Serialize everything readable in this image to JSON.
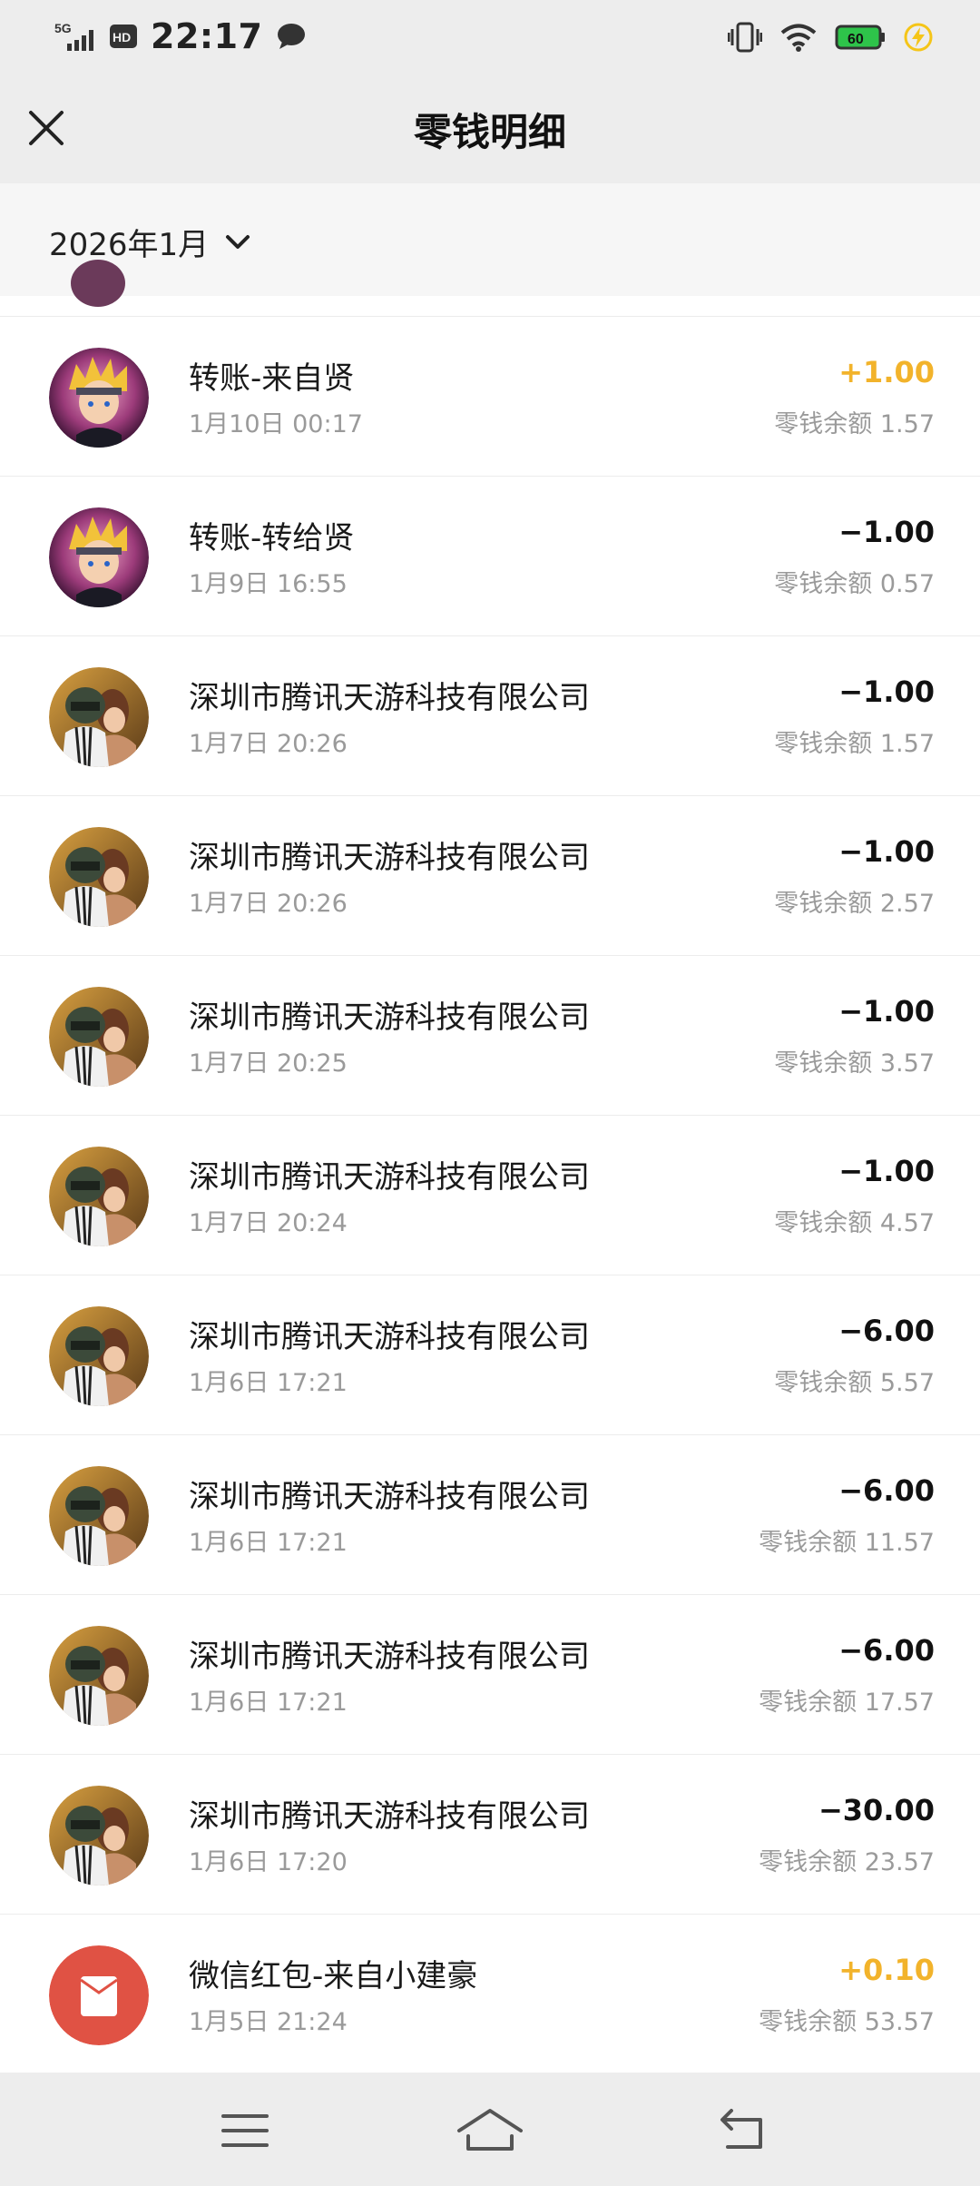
{
  "status": {
    "network": "5G",
    "hd": "HD",
    "time": "22:17",
    "battery": "60"
  },
  "header": {
    "title": "零钱明细"
  },
  "filter": {
    "month": "2026年1月"
  },
  "transactions": [
    {
      "title": "转账-来自贤",
      "time": "1月10日 00:17",
      "amount": "+1.00",
      "balance": "零钱余额 1.57",
      "avatar": "anime-avatar-icon"
    },
    {
      "title": "转账-转给贤",
      "time": "1月9日 16:55",
      "amount": "−1.00",
      "balance": "零钱余额 0.57",
      "avatar": "anime-avatar-icon"
    },
    {
      "title": "深圳市腾讯天游科技有限公司",
      "time": "1月7日 20:26",
      "amount": "−1.00",
      "balance": "零钱余额 1.57",
      "avatar": "game-avatar-icon"
    },
    {
      "title": "深圳市腾讯天游科技有限公司",
      "time": "1月7日 20:26",
      "amount": "−1.00",
      "balance": "零钱余额 2.57",
      "avatar": "game-avatar-icon"
    },
    {
      "title": "深圳市腾讯天游科技有限公司",
      "time": "1月7日 20:25",
      "amount": "−1.00",
      "balance": "零钱余额 3.57",
      "avatar": "game-avatar-icon"
    },
    {
      "title": "深圳市腾讯天游科技有限公司",
      "time": "1月7日 20:24",
      "amount": "−1.00",
      "balance": "零钱余额 4.57",
      "avatar": "game-avatar-icon"
    },
    {
      "title": "深圳市腾讯天游科技有限公司",
      "time": "1月6日 17:21",
      "amount": "−6.00",
      "balance": "零钱余额 5.57",
      "avatar": "game-avatar-icon"
    },
    {
      "title": "深圳市腾讯天游科技有限公司",
      "time": "1月6日 17:21",
      "amount": "−6.00",
      "balance": "零钱余额 11.57",
      "avatar": "game-avatar-icon"
    },
    {
      "title": "深圳市腾讯天游科技有限公司",
      "time": "1月6日 17:21",
      "amount": "−6.00",
      "balance": "零钱余额 17.57",
      "avatar": "game-avatar-icon"
    },
    {
      "title": "深圳市腾讯天游科技有限公司",
      "time": "1月6日 17:20",
      "amount": "−30.00",
      "balance": "零钱余额 23.57",
      "avatar": "game-avatar-icon"
    },
    {
      "title": "微信红包-来自小建豪",
      "time": "1月5日 21:24",
      "amount": "+0.10",
      "balance": "零钱余额 53.57",
      "avatar": "red-packet-icon"
    }
  ],
  "colors": {
    "positive": "#f2b32b",
    "negative": "#111111",
    "bar_bg": "#ededed",
    "red_packet": "#e05244"
  }
}
